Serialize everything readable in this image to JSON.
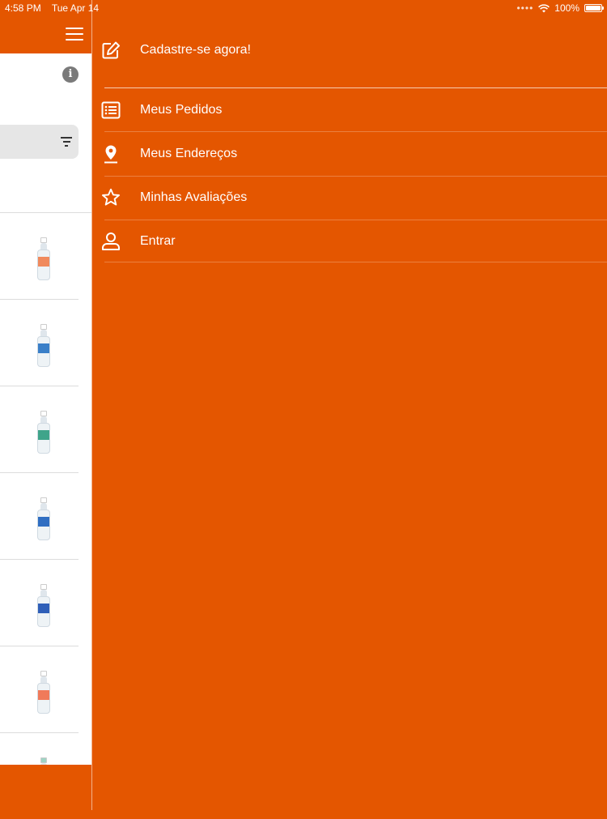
{
  "status_bar": {
    "time": "4:58 PM",
    "date": "Tue Apr 14",
    "battery": "100%",
    "battery_level": 1.0
  },
  "background_app": {
    "header_icon": "hamburger-menu-icon",
    "info_icon": "info-icon",
    "info_glyph": "i",
    "filter_icon": "filter-icon",
    "products": [
      {
        "cap": "#ffffff",
        "label": "#f08a5d"
      },
      {
        "cap": "#ffffff",
        "label": "#3a7fc8"
      },
      {
        "cap": "#ffffff",
        "label": "#3fa48a"
      },
      {
        "cap": "#ffffff",
        "label": "#2f6ec2"
      },
      {
        "cap": "#ffffff",
        "label": "#2f5fb8"
      },
      {
        "cap": "#ffffff",
        "label": "#f07a5a"
      },
      {
        "cap": "#9fd4c4",
        "label": "#e8eef2"
      }
    ]
  },
  "drawer": {
    "items": [
      {
        "label": "Cadastre-se agora!",
        "icon": "edit-icon"
      },
      {
        "label": "Meus Pedidos",
        "icon": "list-icon"
      },
      {
        "label": "Meus Endereços",
        "icon": "location-pin-icon"
      },
      {
        "label": "Minhas Avaliações",
        "icon": "star-icon"
      },
      {
        "label": "Entrar",
        "icon": "user-icon"
      }
    ]
  },
  "colors": {
    "brand_orange": "#e45600",
    "white": "#ffffff"
  }
}
